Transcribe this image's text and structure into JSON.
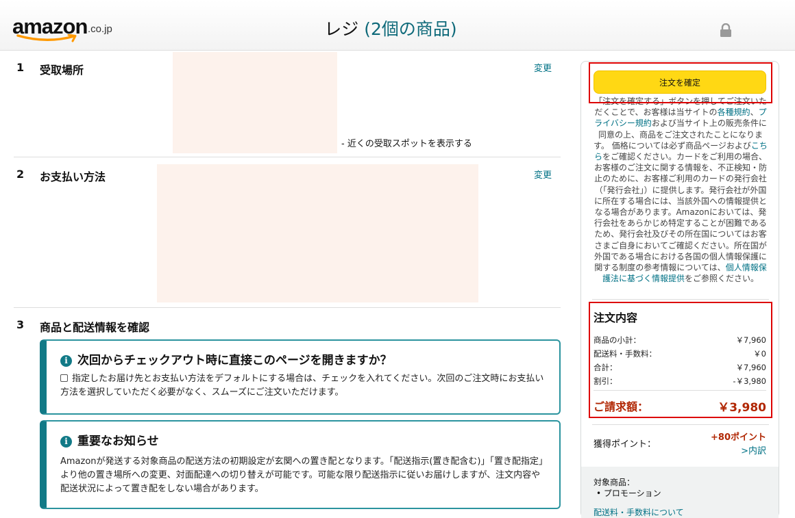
{
  "header": {
    "logo_text": "amazon",
    "logo_suffix": ".co.jp",
    "title": "レジ",
    "item_count": "(2個の商品)"
  },
  "sections": {
    "pickup": {
      "number": "1",
      "title": "受取場所",
      "change_label": "変更",
      "nearby_link": "- 近くの受取スポットを表示する"
    },
    "payment": {
      "number": "2",
      "title": "お支払い方法",
      "change_label": "変更"
    },
    "review": {
      "number": "3",
      "title": "商品と配送情報を確認"
    }
  },
  "checkout_notice": {
    "title": "次回からチェックアウト時に直接このページを開きますか？",
    "text": "指定したお届け先とお支払い方法をデフォルトにする場合は、チェックを入れてください。次回のご注文時にお支払い方法を選択していただく必要がなく、スムーズにご注文いただけます。"
  },
  "important_notice": {
    "title": "重要なお知らせ",
    "text": "Amazonが発送する対象商品の配送方法の初期設定が玄関への置き配となります。「配送指示(置き配含む)」「置き配指定」より他の置き場所への変更、対面配達への切り替えが可能です。可能な限り配送指示に従いお届けしますが、注文内容や配送状況によって置き配をしない場合があります。"
  },
  "order_panel": {
    "place_order_label": "注文を確定",
    "legal": {
      "p1": "「注文を確定する」ボタンを押してご注文いただくことで、お客様は当サイトの",
      "terms_link": "各種規約",
      "p2": "、",
      "privacy_link": "プライバシー規約",
      "p3": "および当サイト上の販売条件に同意の上、商品をご注文されたことになります。 価格については必ず商品ページおよび",
      "here_link": "こちら",
      "p4": "をご確認ください。カードをご利用の場合、お客様のご注文に関する情報を、不正検知・防止のために、お客様ご利用のカードの発行会社（「発行会社」）に提供します。発行会社が外国に所在する場合には、当該外国への情報提供となる場合があります。Amazonにおいては、発行会社をあらかじめ特定することが困難であるため、発行会社及びその所在国についてはお客さまご自身においてご確認ください。所在国が外国である場合における各国の個人情報保護に関する制度の参考情報については、",
      "law_link": "個人情報保護法に基づく情報提供",
      "p5": "をご参照ください。"
    },
    "summary": {
      "title": "注文内容",
      "rows": [
        {
          "label": "商品の小計：",
          "value": "￥7,960"
        },
        {
          "label": "配送料・手数料：",
          "value": "￥0"
        },
        {
          "label": "合計：",
          "value": "￥7,960"
        },
        {
          "label": "割引：",
          "value": "-￥3,980"
        }
      ],
      "total_label": "ご請求額：",
      "total_value": "￥3,980"
    },
    "points": {
      "label": "獲得ポイント：",
      "value": "+80ポイント",
      "detail_link": ">内訳"
    },
    "target": {
      "label": "対象商品：",
      "item": "プロモーション",
      "shipping_link": "配送料・手数料について"
    }
  }
}
